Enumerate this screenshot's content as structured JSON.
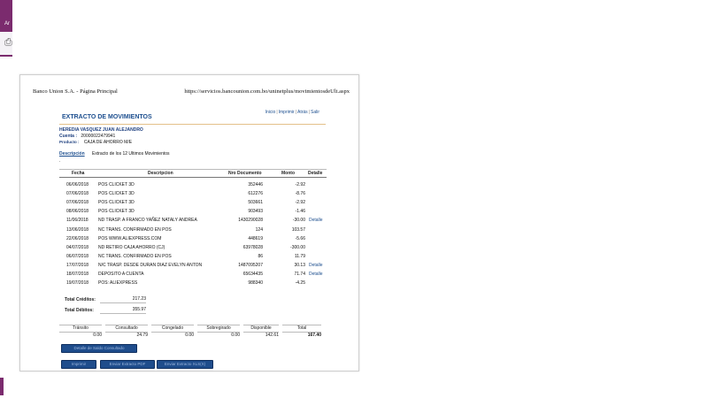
{
  "app": {
    "corner_text": "Ar"
  },
  "header": {
    "left": "Banco Union S.A. - Página Principal",
    "right": "https://servicios.bancounion.com.bo/uninetplus/movimientosdeUlt.aspx"
  },
  "links": [
    "Inicio",
    "Imprimir",
    "Atrás",
    "Salir"
  ],
  "title": "EXTRACTO DE MOVIMIENTOS",
  "account": {
    "name": "HEREDIA VASQUEZ JUAN ALEJANDRO",
    "cuenta_label": "Cuenta :",
    "cuenta_value": "2000002247994​1",
    "producto_label": "Producto :",
    "producto_value": "CAJA DE AHORRO M/E"
  },
  "description": {
    "label": "Descripción",
    "value": "Extracto de los 12 Ultimos Movimientos",
    "dot": "."
  },
  "table": {
    "headers": [
      "Fecha",
      "Descripcion",
      "Nro Documento",
      "Monto",
      "Detalle"
    ],
    "rows": [
      {
        "fecha": "06/06/2018",
        "desc": "POS CLICKET 3D",
        "nro": "352446",
        "monto": "-2.92",
        "detalle": ""
      },
      {
        "fecha": "07/06/2018",
        "desc": "POS CLICKET 3D",
        "nro": "612276",
        "monto": "-8.76",
        "detalle": ""
      },
      {
        "fecha": "07/06/2018",
        "desc": "POS CLICKET 3D",
        "nro": "503661",
        "monto": "-2.92",
        "detalle": ""
      },
      {
        "fecha": "08/06/2018",
        "desc": "POS CLICKET 3D",
        "nro": "903493",
        "monto": "-1.46",
        "detalle": ""
      },
      {
        "fecha": "11/06/2018",
        "desc": "ND TRASP. A FRANCO YAÑEZ NATALY ANDREA",
        "nro": "1430290028",
        "monto": "-30.00",
        "detalle": "Detalle"
      },
      {
        "fecha": "13/06/2018",
        "desc": "NC TRANS. CONFIRMADO EN POS",
        "nro": "124",
        "monto": "103.57",
        "detalle": ""
      },
      {
        "fecha": "22/06/2018",
        "desc": "POS WWW.ALIEXPRESS.COM",
        "nro": "448619",
        "monto": "-5.66",
        "detalle": ""
      },
      {
        "fecha": "04/07/2018",
        "desc": "ND RETIRO CAJA AHORRO (CJ)",
        "nro": "63978028",
        "monto": "-300.00",
        "detalle": ""
      },
      {
        "fecha": "06/07/2018",
        "desc": "NC TRANS. CONFIRMADO EN POS",
        "nro": "86",
        "monto": "11.79",
        "detalle": ""
      },
      {
        "fecha": "17/07/2018",
        "desc": "N/C TRASP. DESDE DURAN DIAZ EVELYN ANTON",
        "nro": "1487095207",
        "monto": "30.13",
        "detalle": "Detalle"
      },
      {
        "fecha": "18/07/2018",
        "desc": "DEPOSITO A CUENTA",
        "nro": "65634435",
        "monto": "71.74",
        "detalle": "Detalle"
      },
      {
        "fecha": "19/07/2018",
        "desc": "POS: ALIEXPRESS",
        "nro": "988340",
        "monto": "-4.25",
        "detalle": ""
      }
    ]
  },
  "totals": {
    "creditos_label": "Total Créditos:",
    "creditos_value": "217.23",
    "debitos_label": "Total Débitos:",
    "debitos_value": "355.97"
  },
  "summary": {
    "headers": [
      "Tránsito",
      "Consultado",
      "Congelado",
      "Sobregirado",
      "Disponible",
      "Total"
    ],
    "values": [
      "0.00",
      "24.79",
      "0.00",
      "0.00",
      "142.61",
      "167.40"
    ]
  },
  "buttons": {
    "detalle_saldo": "Detalle de Saldo Consultado",
    "imprimir": "Imprimir",
    "enviar_pdf": "Enviar Extracto PDF",
    "enviar_xlsx": "Enviar Extracto XLS(X)"
  }
}
